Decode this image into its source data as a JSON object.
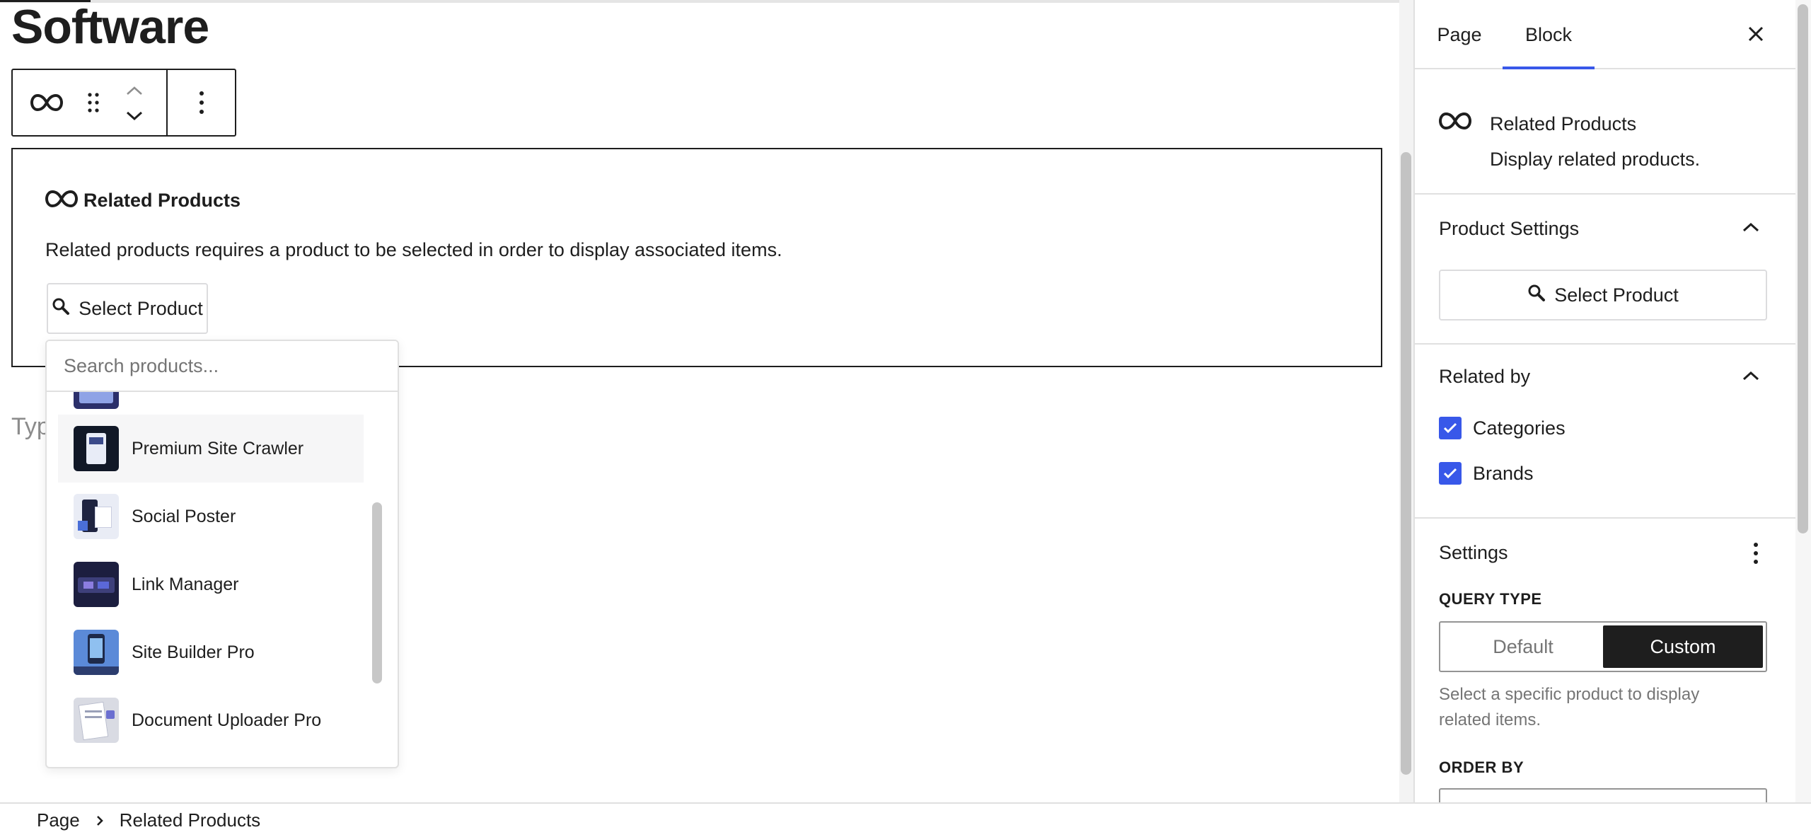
{
  "page": {
    "title": "Software",
    "type_placeholder": "Typ"
  },
  "toolbar": {
    "block_icon": "infinity-icon",
    "drag_icon": "drag-handle-icon",
    "move_icons": [
      "chevron-up-icon",
      "chevron-down-icon"
    ],
    "options_icon": "more-vertical-icon"
  },
  "block": {
    "heading": "Related Products",
    "description": "Related products requires a product to be selected in order to display associated items.",
    "select_button_label": "Select Product"
  },
  "dropdown": {
    "search_placeholder": "Search products...",
    "items": [
      {
        "name": "",
        "thumb_color": "#2b2f6a",
        "partial": true
      },
      {
        "name": "Premium Site Crawler",
        "thumb_color": "#111827",
        "active": true
      },
      {
        "name": "Social Poster",
        "thumb_color": "#e9ecf5"
      },
      {
        "name": "Link Manager",
        "thumb_color": "#1c1e3f"
      },
      {
        "name": "Site Builder Pro",
        "thumb_color": "#5b8ad8"
      },
      {
        "name": "Document Uploader Pro",
        "thumb_color": "#d9dbe3"
      }
    ]
  },
  "sidebar": {
    "tabs": [
      {
        "label": "Page",
        "active": false
      },
      {
        "label": "Block",
        "active": true
      }
    ],
    "card": {
      "title": "Related Products",
      "description": "Display related products."
    },
    "product_settings": {
      "title": "Product Settings",
      "select_button_label": "Select Product"
    },
    "related_by": {
      "title": "Related by",
      "options": [
        {
          "label": "Categories",
          "checked": true
        },
        {
          "label": "Brands",
          "checked": true
        }
      ]
    },
    "settings": {
      "title": "Settings",
      "query_type_label": "QUERY TYPE",
      "query_options": [
        "Default",
        "Custom"
      ],
      "query_selected": "Custom",
      "query_help": "Select a specific product to display related items.",
      "order_by_label": "ORDER BY"
    }
  },
  "breadcrumb": {
    "items": [
      "Page",
      "Related Products"
    ]
  },
  "colors": {
    "accent": "#3858e9",
    "text": "#1e1e1e",
    "border": "#e0e0e0",
    "muted": "#757575"
  }
}
